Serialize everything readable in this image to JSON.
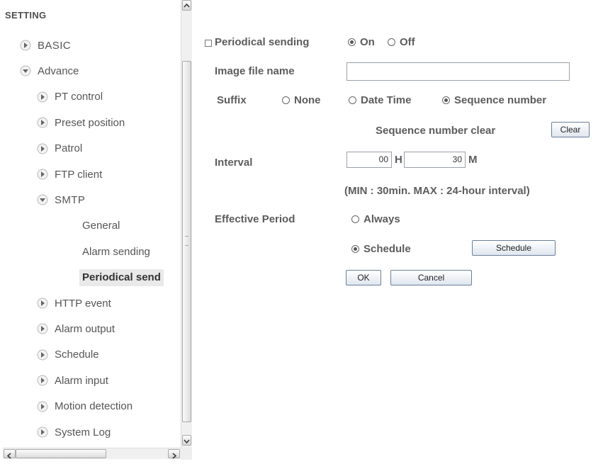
{
  "sidebar": {
    "title": "SETTING",
    "items": [
      {
        "label": "BASIC",
        "level": 1,
        "arrow": "right-arrow-icon",
        "style": "upper"
      },
      {
        "label": "Advance",
        "level": 1,
        "arrow": "down-arrow-icon"
      },
      {
        "label": "PT control",
        "level": 2,
        "arrow": "right-arrow-icon"
      },
      {
        "label": "Preset position",
        "level": 2,
        "arrow": "right-arrow-icon"
      },
      {
        "label": "Patrol",
        "level": 2,
        "arrow": "right-arrow-icon"
      },
      {
        "label": "FTP client",
        "level": 2,
        "arrow": "right-arrow-icon"
      },
      {
        "label": "SMTP",
        "level": 2,
        "arrow": "down-arrow-icon",
        "style": "upper"
      },
      {
        "label": "General",
        "level": 3
      },
      {
        "label": "Alarm sending",
        "level": 3
      },
      {
        "label": "Periodical send",
        "level": 3,
        "selected": true
      },
      {
        "label": "HTTP event",
        "level": 2,
        "arrow": "right-arrow-icon"
      },
      {
        "label": "Alarm output",
        "level": 2,
        "arrow": "right-arrow-icon"
      },
      {
        "label": "Schedule",
        "level": 2,
        "arrow": "right-arrow-icon"
      },
      {
        "label": "Alarm input",
        "level": 2,
        "arrow": "right-arrow-icon"
      },
      {
        "label": "Motion detection",
        "level": 2,
        "arrow": "right-arrow-icon"
      },
      {
        "label": "System Log",
        "level": 2,
        "arrow": "right-arrow-icon"
      }
    ]
  },
  "form": {
    "section_label": "Periodical sending",
    "on_label": "On",
    "off_label": "Off",
    "periodical_selected": "On",
    "image_file_name_label": "Image file name",
    "image_file_name_value": "",
    "suffix_label": "Suffix",
    "suffix_options": [
      "None",
      "Date Time",
      "Sequence number"
    ],
    "suffix_selected": "Sequence number",
    "sequence_clear_label": "Sequence number clear",
    "clear_button": "Clear",
    "interval_label": "Interval",
    "interval_hours": "00",
    "hours_unit": "H",
    "interval_minutes": "30",
    "minutes_unit": "M",
    "interval_note": "(MIN : 30min. MAX : 24-hour interval)",
    "effective_period_label": "Effective Period",
    "always_label": "Always",
    "schedule_label": "Schedule",
    "effective_selected": "Schedule",
    "schedule_button": "Schedule",
    "ok_button": "OK",
    "cancel_button": "Cancel"
  }
}
